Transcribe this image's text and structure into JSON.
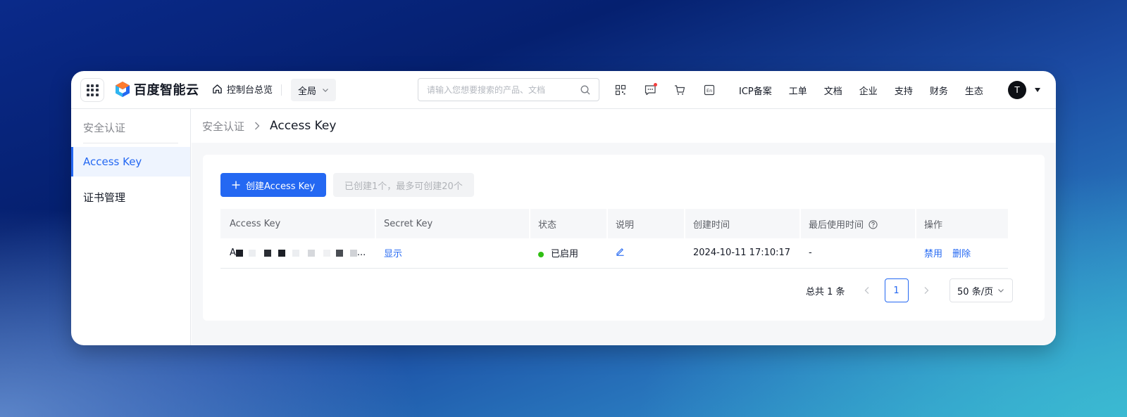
{
  "header": {
    "brand": "百度智能云",
    "home_label": "控制台总览",
    "region_label": "全局",
    "search_placeholder": "请输入您想要搜索的产品、文档",
    "icons": [
      "qrcode-icon",
      "message-icon",
      "cart-icon",
      "language-icon"
    ],
    "nav": [
      "ICP备案",
      "工单",
      "文档",
      "企业",
      "支持",
      "财务",
      "生态"
    ],
    "avatar_initial": "T"
  },
  "sidebar": {
    "title": "安全认证",
    "items": [
      {
        "label": "Access Key",
        "active": true
      },
      {
        "label": "证书管理",
        "active": false
      }
    ]
  },
  "breadcrumb": {
    "parent": "安全认证",
    "current": "Access Key"
  },
  "toolbar": {
    "create_label": "创建Access Key",
    "quota_text": "已创建1个，最多可创建20个"
  },
  "table": {
    "columns": [
      "Access Key",
      "Secret Key",
      "状态",
      "说明",
      "创建时间",
      "最后使用时间",
      "操作"
    ],
    "rows": [
      {
        "access_key": "A",
        "access_key_suffix": "...",
        "secret_key_action": "显示",
        "status": "已启用",
        "created_at": "2024-10-11 17:10:17",
        "last_used": "-",
        "actions": [
          "禁用",
          "删除"
        ]
      }
    ]
  },
  "pagination": {
    "total_text": "总共 1 条",
    "current_page": "1",
    "page_size": "50 条/页"
  },
  "colors": {
    "accent": "#2468f2",
    "status_enabled": "#30bf13",
    "notification_dot": "#f33e3e"
  }
}
